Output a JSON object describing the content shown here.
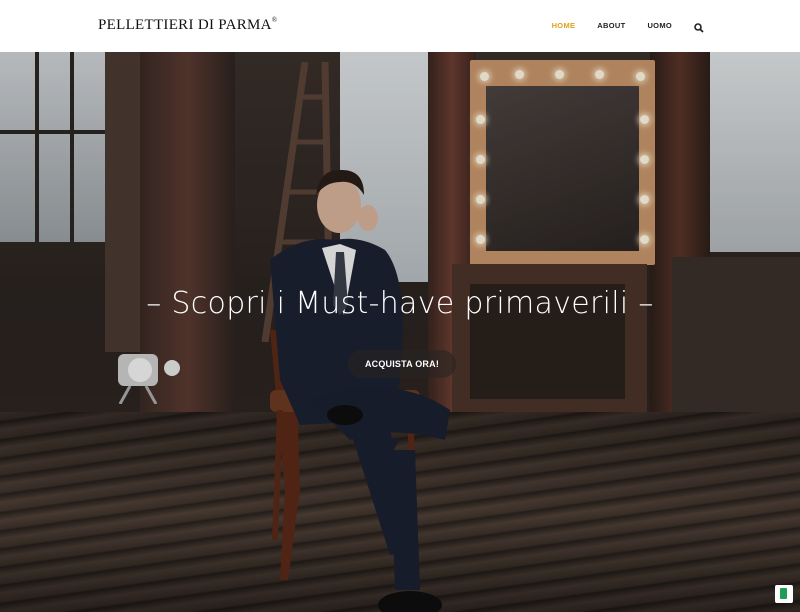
{
  "header": {
    "brand": "PELLETTIERI DI PARMA",
    "brand_mark": "®",
    "nav": [
      {
        "label": "HOME",
        "active": true
      },
      {
        "label": "ABOUT",
        "active": false
      },
      {
        "label": "UOMO",
        "active": false
      }
    ],
    "search_icon": "search-icon",
    "accent_color": "#e0a11b"
  },
  "hero": {
    "headline": "– Scopri i Must-have primaverili –",
    "cta_label": "ACQUISTA ORA!"
  },
  "corner_badge_icon": "status-badge-icon"
}
